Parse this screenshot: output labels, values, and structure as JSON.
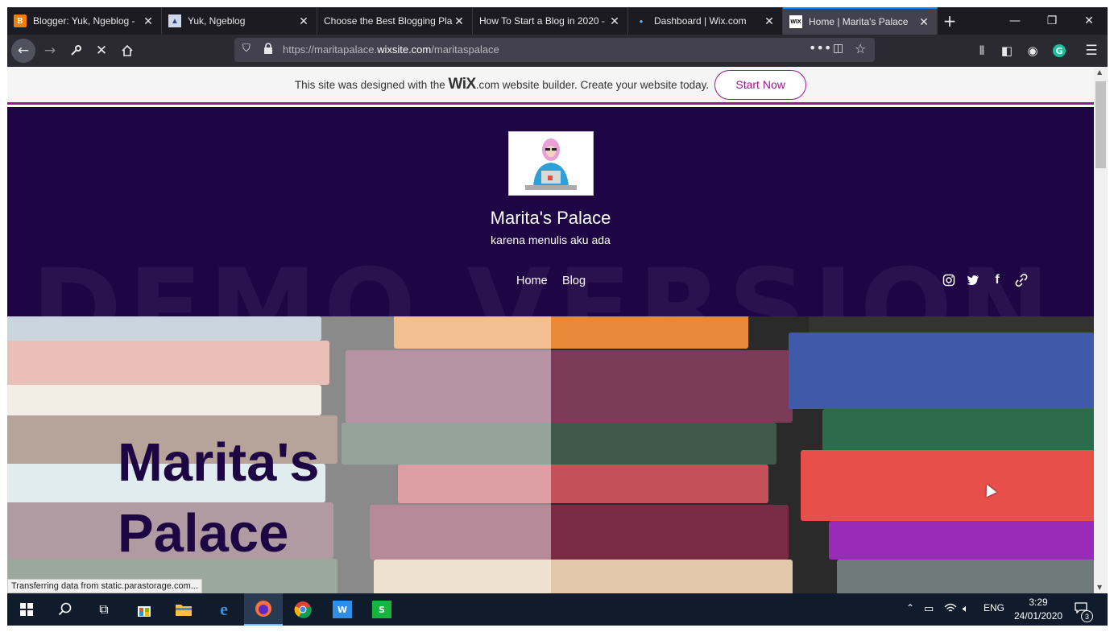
{
  "browser": {
    "tabs": [
      {
        "title": "Blogger: Yuk, Ngeblog - ",
        "active": false
      },
      {
        "title": "Yuk, Ngeblog",
        "active": false
      },
      {
        "title": "Choose the Best Blogging Pla",
        "active": false
      },
      {
        "title": "How To Start a Blog in 2020 -",
        "active": false
      },
      {
        "title": "Dashboard | Wix.com",
        "active": false
      },
      {
        "title": "Home | Marita's Palace",
        "active": true
      }
    ],
    "url_prefix": "https://maritapalace.",
    "url_domain": "wixsite.com",
    "url_path": "/maritaspalace",
    "status_text": "Transferring data from static.parastorage.com..."
  },
  "banner": {
    "text_before": "This site was designed with the ",
    "logo": "WiX",
    "text_after": ".com website builder. Create your website today.",
    "cta": "Start Now",
    "accent": "#a0138e"
  },
  "site": {
    "title": "Marita's Palace",
    "tagline": "karena menulis aku ada",
    "menu": [
      "Home",
      "Blog"
    ],
    "watermark": "DEMO VERSION",
    "header_bg": "#1e0645",
    "social_icons": [
      "instagram-icon",
      "twitter-icon",
      "facebook-icon",
      "link-icon"
    ]
  },
  "hero": {
    "title": "Marita's\nPalace"
  },
  "taskbar": {
    "language": "ENG",
    "time": "3:29",
    "date": "24/01/2020",
    "notifications": "3"
  }
}
